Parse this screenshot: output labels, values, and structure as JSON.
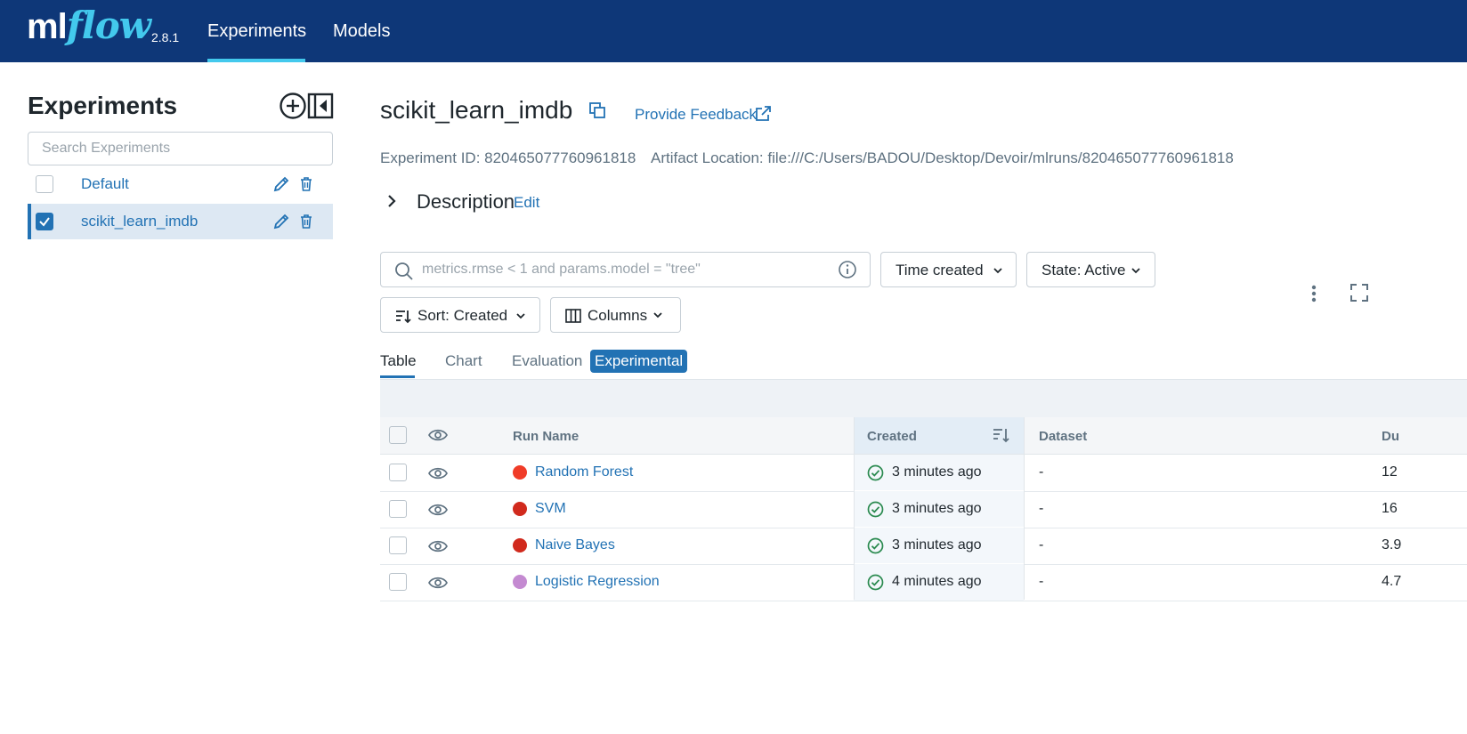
{
  "header": {
    "logo_ml": "ml",
    "logo_flow": "flow",
    "version": "2.8.1",
    "nav": [
      {
        "label": "Experiments"
      },
      {
        "label": "Models"
      }
    ]
  },
  "sidebar": {
    "title": "Experiments",
    "search_placeholder": "Search Experiments",
    "items": [
      {
        "label": "Default",
        "selected": false
      },
      {
        "label": "scikit_learn_imdb",
        "selected": true
      }
    ]
  },
  "main": {
    "title": "scikit_learn_imdb",
    "feedback": "Provide Feedback",
    "experiment_id": "Experiment ID: 820465077760961818",
    "artifact_location": "Artifact Location: file:///C:/Users/BADOU/Desktop/Devoir/mlruns/820465077760961818",
    "description_title": "Description",
    "description_edit": "Edit",
    "filter_placeholder": "metrics.rmse < 1 and params.model = \"tree\"",
    "time_created": "Time created",
    "state": "State: Active",
    "sort": "Sort: Created",
    "columns": "Columns",
    "tabs": [
      {
        "label": "Table"
      },
      {
        "label": "Chart"
      },
      {
        "label": "Evaluation"
      }
    ],
    "experimental_badge": "Experimental"
  },
  "table": {
    "headers": {
      "run_name": "Run Name",
      "created": "Created",
      "dataset": "Dataset",
      "duration": "Du"
    },
    "rows": [
      {
        "name": "Random Forest",
        "color": "#f03c28",
        "created": "3 minutes ago",
        "dataset": "-",
        "duration": "12"
      },
      {
        "name": "SVM",
        "color": "#d12a1d",
        "created": "3 minutes ago",
        "dataset": "-",
        "duration": "16"
      },
      {
        "name": "Naive Bayes",
        "color": "#d12a1d",
        "created": "3 minutes ago",
        "dataset": "-",
        "duration": "3.9"
      },
      {
        "name": "Logistic Regression",
        "color": "#c48ad1",
        "created": "4 minutes ago",
        "dataset": "-",
        "duration": "4.7"
      }
    ]
  },
  "colors": {
    "header_bg": "#0e3778",
    "accent": "#43c9ed",
    "link": "#2272b4",
    "success": "#2a8a4f"
  }
}
